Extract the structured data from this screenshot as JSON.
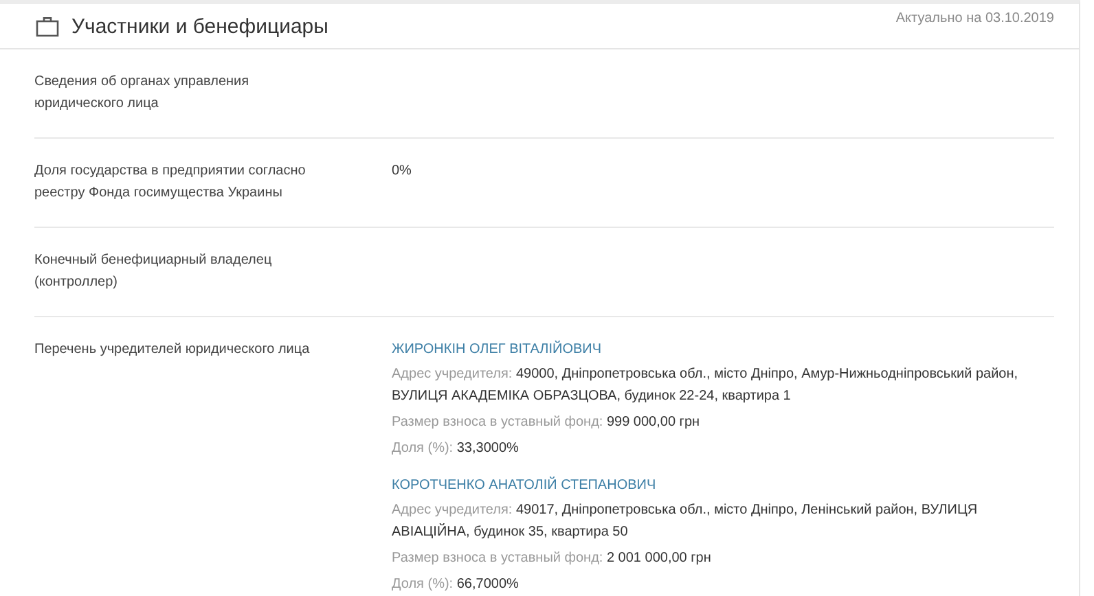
{
  "header": {
    "title": "Участники и бенефициары",
    "updated": "Актуально на 03.10.2019"
  },
  "rows": [
    {
      "label": "Сведения об органах управления юридического лица",
      "kind": "empty"
    },
    {
      "label": "Доля государства в предприятии согласно реестру Фонда госимущества Украины",
      "kind": "text",
      "value": "0%"
    },
    {
      "label": "Конечный бенефициарный владелец (контроллер)",
      "kind": "empty"
    },
    {
      "label": "Перечень учредителей юридического лица",
      "kind": "founders",
      "founders": [
        {
          "name": "ЖИРОНКІН ОЛЕГ ВІТАЛІЙОВИЧ",
          "fields": [
            {
              "label": "Адрес учредителя:",
              "value": "49000, Дніпропетровська обл., місто Дніпро, Амур-Нижньодніпровський район, ВУЛИЦЯ АКАДЕМІКА ОБРАЗЦОВА, будинок 22-24, квартира 1"
            },
            {
              "label": "Размер взноса в уставный фонд:",
              "value": "999 000,00 грн"
            },
            {
              "label": "Доля (%):",
              "value": "33,3000%"
            }
          ]
        },
        {
          "name": "КОРОТЧЕНКО АНАТОЛІЙ СТЕПАНОВИЧ",
          "fields": [
            {
              "label": "Адрес учредителя:",
              "value": "49017, Дніпропетровська обл., місто Дніпро, Ленінський район, ВУЛИЦЯ АВІАЦІЙНА, будинок 35, квартира 50"
            },
            {
              "label": "Размер взноса в уставный фонд:",
              "value": "2 001 000,00 грн"
            },
            {
              "label": "Доля (%):",
              "value": "66,7000%"
            }
          ]
        }
      ]
    }
  ]
}
